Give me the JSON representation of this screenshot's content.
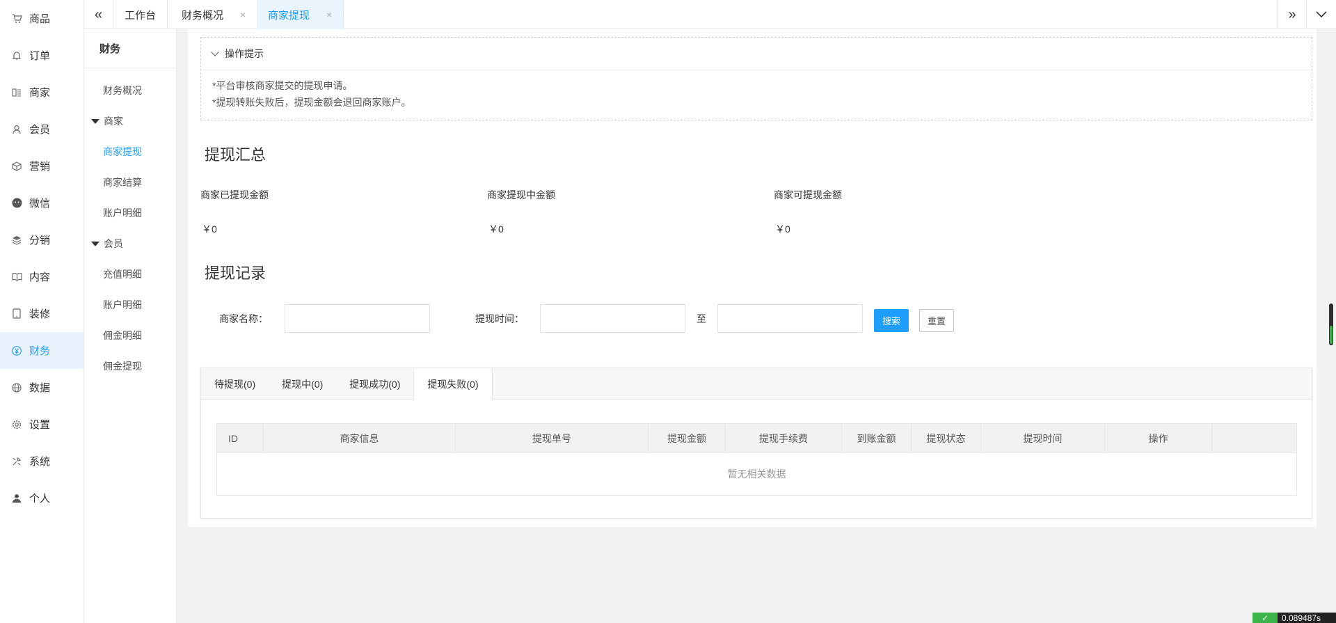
{
  "main_nav": [
    {
      "label": "商品",
      "icon": "cart-icon"
    },
    {
      "label": "订单",
      "icon": "bell-icon"
    },
    {
      "label": "商家",
      "icon": "store-icon"
    },
    {
      "label": "会员",
      "icon": "user-icon"
    },
    {
      "label": "营销",
      "icon": "box-icon"
    },
    {
      "label": "微信",
      "icon": "wechat-icon"
    },
    {
      "label": "分销",
      "icon": "layers-icon"
    },
    {
      "label": "内容",
      "icon": "book-icon"
    },
    {
      "label": "装修",
      "icon": "tablet-icon"
    },
    {
      "label": "财务",
      "icon": "yen-icon"
    },
    {
      "label": "数据",
      "icon": "globe-icon"
    },
    {
      "label": "设置",
      "icon": "gear-icon"
    },
    {
      "label": "系统",
      "icon": "tools-icon"
    },
    {
      "label": "个人",
      "icon": "person-icon"
    }
  ],
  "sub_nav": {
    "title": "财务",
    "items": [
      {
        "label": "财务概况"
      },
      {
        "label": "商家",
        "group": true
      },
      {
        "label": "商家提现"
      },
      {
        "label": "商家结算"
      },
      {
        "label": "账户明细"
      },
      {
        "label": "会员",
        "group": true
      },
      {
        "label": "充值明细"
      },
      {
        "label": "账户明细"
      },
      {
        "label": "佣金明细"
      },
      {
        "label": "佣金提现"
      }
    ]
  },
  "tabs": {
    "items": [
      {
        "label": "工作台"
      },
      {
        "label": "财务概况",
        "close": "×"
      },
      {
        "label": "商家提现",
        "close": "×"
      }
    ]
  },
  "tips": {
    "title": "操作提示",
    "lines": [
      "*平台审核商家提交的提现申请。",
      "*提现转账失败后，提现金额会退回商家账户。"
    ]
  },
  "summary": {
    "title": "提现汇总",
    "stats": [
      {
        "label": "商家已提现金额",
        "value": "￥0"
      },
      {
        "label": "商家提现中金额",
        "value": "￥0"
      },
      {
        "label": "商家可提现金额",
        "value": "￥0"
      }
    ]
  },
  "records": {
    "title": "提现记录",
    "filter": {
      "name_label": "商家名称：",
      "time_label": "提现时间：",
      "to_label": "至",
      "search_btn": "搜索",
      "reset_btn": "重置"
    },
    "status_tabs": [
      {
        "label": "待提现(0)"
      },
      {
        "label": "提现中(0)"
      },
      {
        "label": "提现成功(0)"
      },
      {
        "label": "提现失败(0)"
      }
    ],
    "columns": [
      "ID",
      "商家信息",
      "提现单号",
      "提现金额",
      "提现手续费",
      "到账金额",
      "提现状态",
      "提现时间",
      "操作",
      ""
    ],
    "empty_text": "暂无相关数据"
  },
  "corner_badge": "0.089487s",
  "colors": {
    "accent": "#1e9fff",
    "active_bg": "#e8f2fc"
  }
}
